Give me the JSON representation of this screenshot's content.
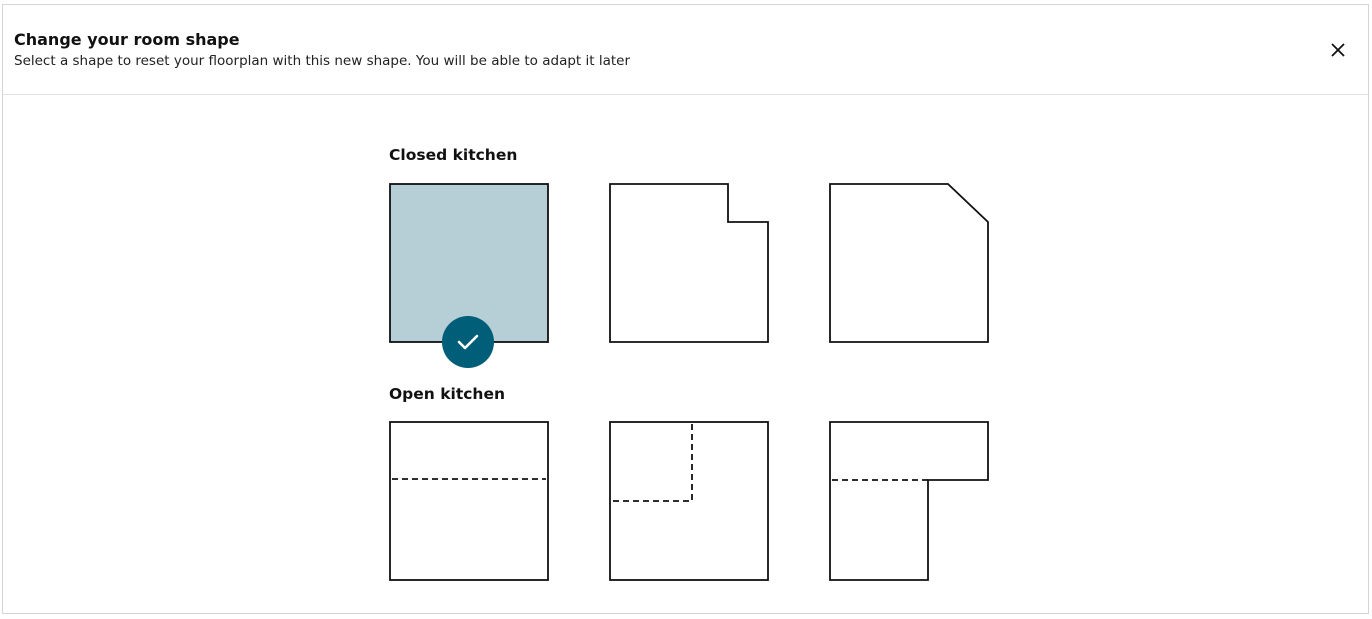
{
  "dialog": {
    "title": "Change your room shape",
    "subtitle": "Select a shape to reset your floorplan with this new shape. You will be able to adapt it later",
    "close_icon": "close-icon"
  },
  "sections": [
    {
      "title": "Closed kitchen",
      "shapes": [
        {
          "name": "square",
          "selected": true
        },
        {
          "name": "notched-corner",
          "selected": false
        },
        {
          "name": "cut-corner",
          "selected": false
        }
      ]
    },
    {
      "title": "Open kitchen",
      "shapes": [
        {
          "name": "square-open-strip",
          "selected": false
        },
        {
          "name": "square-open-corner",
          "selected": false
        },
        {
          "name": "l-shape-open",
          "selected": false
        }
      ]
    }
  ],
  "colors": {
    "selected_fill": "#b6cfd6",
    "accent": "#005e78",
    "outline": "#111111"
  },
  "selected_icon": "checkmark-icon"
}
